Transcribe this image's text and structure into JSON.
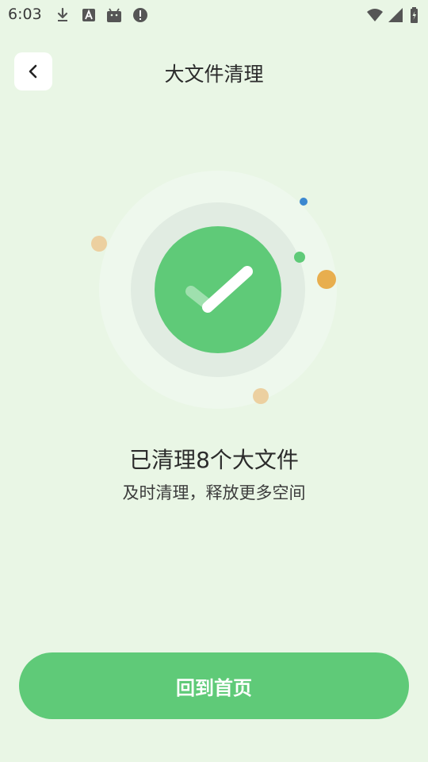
{
  "status_bar": {
    "time": "6:03",
    "left_icons": [
      "download-icon",
      "text-a-icon",
      "android-icon",
      "alert-icon"
    ],
    "right_icons": [
      "wifi-icon",
      "cell-signal-icon",
      "battery-charging-icon"
    ]
  },
  "header": {
    "back_icon": "chevron-left-icon",
    "title": "大文件清理"
  },
  "result": {
    "status_icon": "check-icon",
    "title": "已清理8个大文件",
    "subtitle": "及时清理，释放更多空间"
  },
  "actions": {
    "home_label": "回到首页"
  },
  "colors": {
    "background": "#e9f6e5",
    "accent_green": "#5fca78",
    "dot_blue": "#3b88d0",
    "dot_orange": "#e8ae4e",
    "dot_tan": "#ecd0a0"
  }
}
